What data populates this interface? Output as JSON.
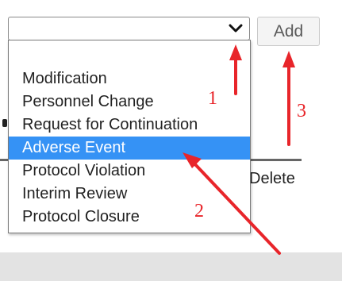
{
  "form": {
    "select": {
      "value": ""
    },
    "add_label": "Add"
  },
  "dropdown": {
    "items": [
      "Modification",
      "Personnel Change",
      "Request for Continuation",
      "Adverse Event",
      "Protocol Violation",
      "Interim Review",
      "Protocol Closure"
    ],
    "selected": "Adverse Event"
  },
  "background": {
    "delete_text": "Delete"
  },
  "annotations": {
    "step1": "1",
    "step2": "2",
    "step3": "3",
    "color": "#e8252a"
  },
  "colors": {
    "highlight": "#3592f5"
  }
}
